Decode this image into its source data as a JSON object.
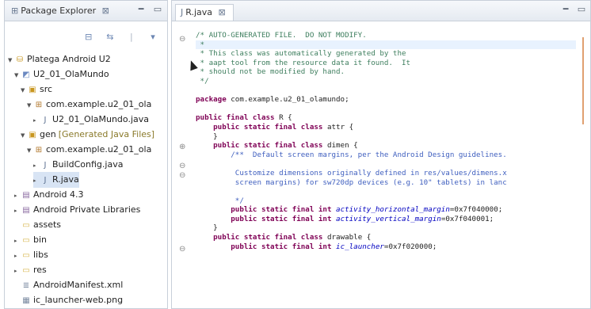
{
  "package_explorer": {
    "tab_label": "Package Explorer",
    "tree": [
      {
        "label": "Platega Android U2",
        "extra": "",
        "indent": 0,
        "twisty": "▼",
        "icon": "project-icon",
        "glyph": "⛁"
      },
      {
        "label": "U2_01_OlaMundo",
        "extra": "",
        "indent": 1,
        "twisty": "▼",
        "icon": "android-project-icon",
        "glyph": "◩"
      },
      {
        "label": "src",
        "extra": "",
        "indent": 2,
        "twisty": "▼",
        "icon": "source-folder-icon",
        "glyph": "▣"
      },
      {
        "label": "com.example.u2_01_ola",
        "extra": "",
        "indent": 3,
        "twisty": "▼",
        "icon": "package-icon",
        "glyph": "⊞"
      },
      {
        "label": "U2_01_OlaMundo.java",
        "extra": "",
        "indent": 4,
        "twisty": "▸",
        "icon": "java-file-icon",
        "glyph": "J"
      },
      {
        "label": "gen",
        "extra": "[Generated Java Files]",
        "indent": 2,
        "twisty": "▼",
        "icon": "gen-folder-icon",
        "glyph": "▣"
      },
      {
        "label": "com.example.u2_01_ola",
        "extra": "",
        "indent": 3,
        "twisty": "▼",
        "icon": "package-icon",
        "glyph": "⊞"
      },
      {
        "label": "BuildConfig.java",
        "extra": "",
        "indent": 4,
        "twisty": "▸",
        "icon": "java-file-icon",
        "glyph": "J"
      },
      {
        "label": "R.java",
        "extra": "",
        "indent": 4,
        "twisty": "▸",
        "icon": "java-file-icon",
        "glyph": "J",
        "selected": true
      },
      {
        "label": "Android 4.3",
        "extra": "",
        "indent": 1,
        "twisty": "▸",
        "icon": "library-icon",
        "glyph": "▤"
      },
      {
        "label": "Android Private Libraries",
        "extra": "",
        "indent": 1,
        "twisty": "▸",
        "icon": "library-icon",
        "glyph": "▤"
      },
      {
        "label": "assets",
        "extra": "",
        "indent": 1,
        "twisty": "",
        "icon": "folder-icon",
        "glyph": "▭"
      },
      {
        "label": "bin",
        "extra": "",
        "indent": 1,
        "twisty": "▸",
        "icon": "folder-icon",
        "glyph": "▭"
      },
      {
        "label": "libs",
        "extra": "",
        "indent": 1,
        "twisty": "▸",
        "icon": "folder-icon",
        "glyph": "▭"
      },
      {
        "label": "res",
        "extra": "",
        "indent": 1,
        "twisty": "▸",
        "icon": "folder-icon",
        "glyph": "▭"
      },
      {
        "label": "AndroidManifest.xml",
        "extra": "",
        "indent": 1,
        "twisty": "",
        "icon": "xml-file-icon",
        "glyph": "≣"
      },
      {
        "label": "ic_launcher-web.png",
        "extra": "",
        "indent": 1,
        "twisty": "",
        "icon": "image-file-icon",
        "glyph": "▦"
      }
    ]
  },
  "editor": {
    "tab_label": "R.java",
    "lines": [
      [
        {
          "t": "/* AUTO-GENERATED FILE.  DO NOT MODIFY.",
          "c": "cm"
        }
      ],
      [
        {
          "t": " *",
          "c": "cm"
        }
      ],
      [
        {
          "t": " * This class was automatically generated by the",
          "c": "cm"
        }
      ],
      [
        {
          "t": " * aapt tool from the resource data it found.  It",
          "c": "cm"
        }
      ],
      [
        {
          "t": " * should not be modified by hand.",
          "c": "cm"
        }
      ],
      [
        {
          "t": " */",
          "c": "cm"
        }
      ],
      [
        {
          "t": "",
          "c": ""
        }
      ],
      [
        {
          "t": "package",
          "c": "kw"
        },
        {
          "t": " com.example.u2_01_olamundo;",
          "c": ""
        }
      ],
      [
        {
          "t": "",
          "c": ""
        }
      ],
      [
        {
          "t": "public final class",
          "c": "kw"
        },
        {
          "t": " R {",
          "c": ""
        }
      ],
      [
        {
          "t": "    ",
          "c": ""
        },
        {
          "t": "public static final class",
          "c": "kw"
        },
        {
          "t": " attr {",
          "c": ""
        }
      ],
      [
        {
          "t": "    }",
          "c": ""
        }
      ],
      [
        {
          "t": "    ",
          "c": ""
        },
        {
          "t": "public static final class",
          "c": "kw"
        },
        {
          "t": " dimen {",
          "c": ""
        }
      ],
      [
        {
          "t": "        /**  Default screen margins, per the Android Design guidelines.",
          "c": "doc"
        }
      ],
      [
        {
          "t": "",
          "c": ""
        }
      ],
      [
        {
          "t": "         Customize dimensions originally defined in res/values/dimens.x",
          "c": "doc"
        }
      ],
      [
        {
          "t": "         screen margins) for sw720dp devices (e.g. 10\" tablets) in lanc",
          "c": "doc"
        }
      ],
      [
        {
          "t": "",
          "c": ""
        }
      ],
      [
        {
          "t": "         */",
          "c": "doc"
        }
      ],
      [
        {
          "t": "        ",
          "c": ""
        },
        {
          "t": "public static final int",
          "c": "kw"
        },
        {
          "t": " ",
          "c": ""
        },
        {
          "t": "activity_horizontal_margin",
          "c": "fld"
        },
        {
          "t": "=0x7f040000;",
          "c": ""
        }
      ],
      [
        {
          "t": "        ",
          "c": ""
        },
        {
          "t": "public static final int",
          "c": "kw"
        },
        {
          "t": " ",
          "c": ""
        },
        {
          "t": "activity_vertical_margin",
          "c": "fld"
        },
        {
          "t": "=0x7f040001;",
          "c": ""
        }
      ],
      [
        {
          "t": "    }",
          "c": ""
        }
      ],
      [
        {
          "t": "    ",
          "c": ""
        },
        {
          "t": "public static final class",
          "c": "kw"
        },
        {
          "t": " drawable {",
          "c": ""
        }
      ],
      [
        {
          "t": "        ",
          "c": ""
        },
        {
          "t": "public static final int",
          "c": "kw"
        },
        {
          "t": " ",
          "c": ""
        },
        {
          "t": "ic_launcher",
          "c": "fld"
        },
        {
          "t": "=0x7f020000;",
          "c": ""
        }
      ]
    ]
  }
}
